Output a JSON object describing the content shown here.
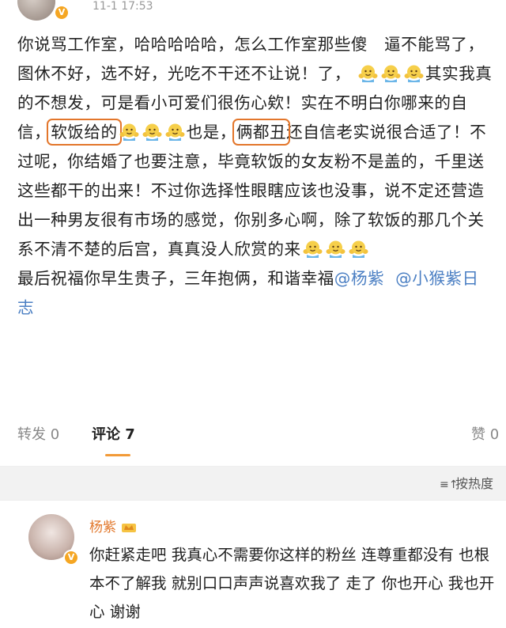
{
  "post": {
    "time": "11-1 17:53",
    "segments": {
      "s1": "你说骂工作室，哈哈哈哈哈，怎么工作室那些傻　逼不能骂了，图休不好，选不好，光吃不干还不让说！了，",
      "s2": "其实我真的不想发，可是看小可爱们很伤心欸！实在不明白你哪来的自信，",
      "h1": "软饭给的",
      "s3": "也是，",
      "h2": "俩都丑",
      "s4": "还自信老实说很合适了！不过呢，你结婚了也要注意，毕竟软饭的女友粉不是盖的，千里送这些都干的出来！不过你选择性眼瞎应该也没事，说不定还营造出一种男友很有市场的感觉，你别多心啊，除了软饭的那几个关系不清不楚的后宫，真真没人欣赏的来",
      "s5": "最后祝福你早生贵子，三年抱俩，和谐幸福",
      "m1": "@杨紫",
      "m2": "@小猴紫日志"
    }
  },
  "tabs": {
    "repost": "转发 0",
    "comment": "评论 7",
    "like": "赞 0"
  },
  "sort_label": "按热度",
  "comment": {
    "name": "杨紫",
    "text": "你赶紧走吧 我真心不需要你这样的粉丝 连尊重都没有 也根本不了解我 就别口口声声说喜欢我了 走了 你也开心 我也开心 谢谢"
  },
  "colors": {
    "highlight": "#e3762b",
    "mention": "#4b7fc3",
    "username": "#e2792e",
    "tab_underline": "#f29a38"
  },
  "icons": {
    "emoji": "doge-shrug-icon",
    "verified": "verified-badge-icon",
    "sort": "sort-icon",
    "crown": "crown-icon"
  }
}
